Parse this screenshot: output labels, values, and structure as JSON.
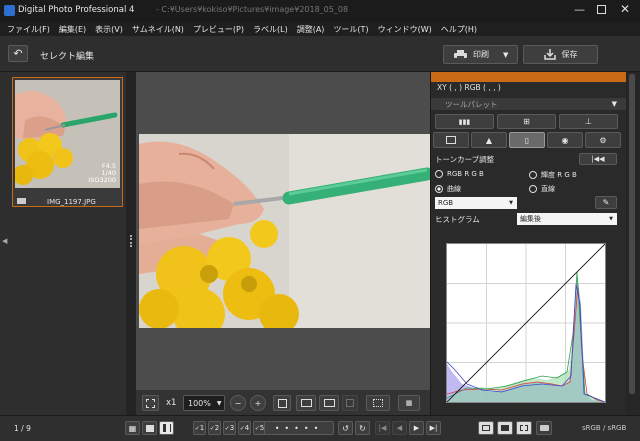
{
  "window": {
    "title": "Digital Photo Professional 4",
    "path": "- C:¥Users¥kokiso¥Pictures¥image¥2018_05_08"
  },
  "menu": [
    "ファイル(F)",
    "編集(E)",
    "表示(V)",
    "サムネイル(N)",
    "プレビュー(P)",
    "ラベル(L)",
    "調整(A)",
    "ツール(T)",
    "ウィンドウ(W)",
    "ヘルプ(H)"
  ],
  "toolbar": {
    "title": "セレクト編集",
    "print_label": "印刷",
    "save_label": "保存"
  },
  "thumbnail": {
    "filename": "IMG_1197.JPG",
    "aperture": "F4.5",
    "shutter": "1/40",
    "iso": "ISO3200"
  },
  "readout": {
    "text": "XY (  ,  ) RGB (  ,  ,  )"
  },
  "tool_palette": {
    "title": "ツールパレット",
    "tone_curve_label": "トーンカーブ調整",
    "rgb_option": "RGB R G B",
    "lum_option": "輝度 R G B",
    "curve_option": "曲線",
    "line_option": "直線",
    "channel_select": "RGB",
    "histogram_label": "ヒストグラム",
    "histogram_select": "編集後"
  },
  "preview_bar": {
    "zoom_1x": "x1",
    "zoom_value": "100%"
  },
  "status": {
    "page": "1 / 9",
    "colorspace": "sRGB / sRGB"
  },
  "rating_labels": [
    "1",
    "2",
    "3",
    "4",
    "5"
  ],
  "colors": {
    "accent": "#c86a16",
    "curve_green": "#33b07a",
    "yarn": "#f3c81c"
  }
}
